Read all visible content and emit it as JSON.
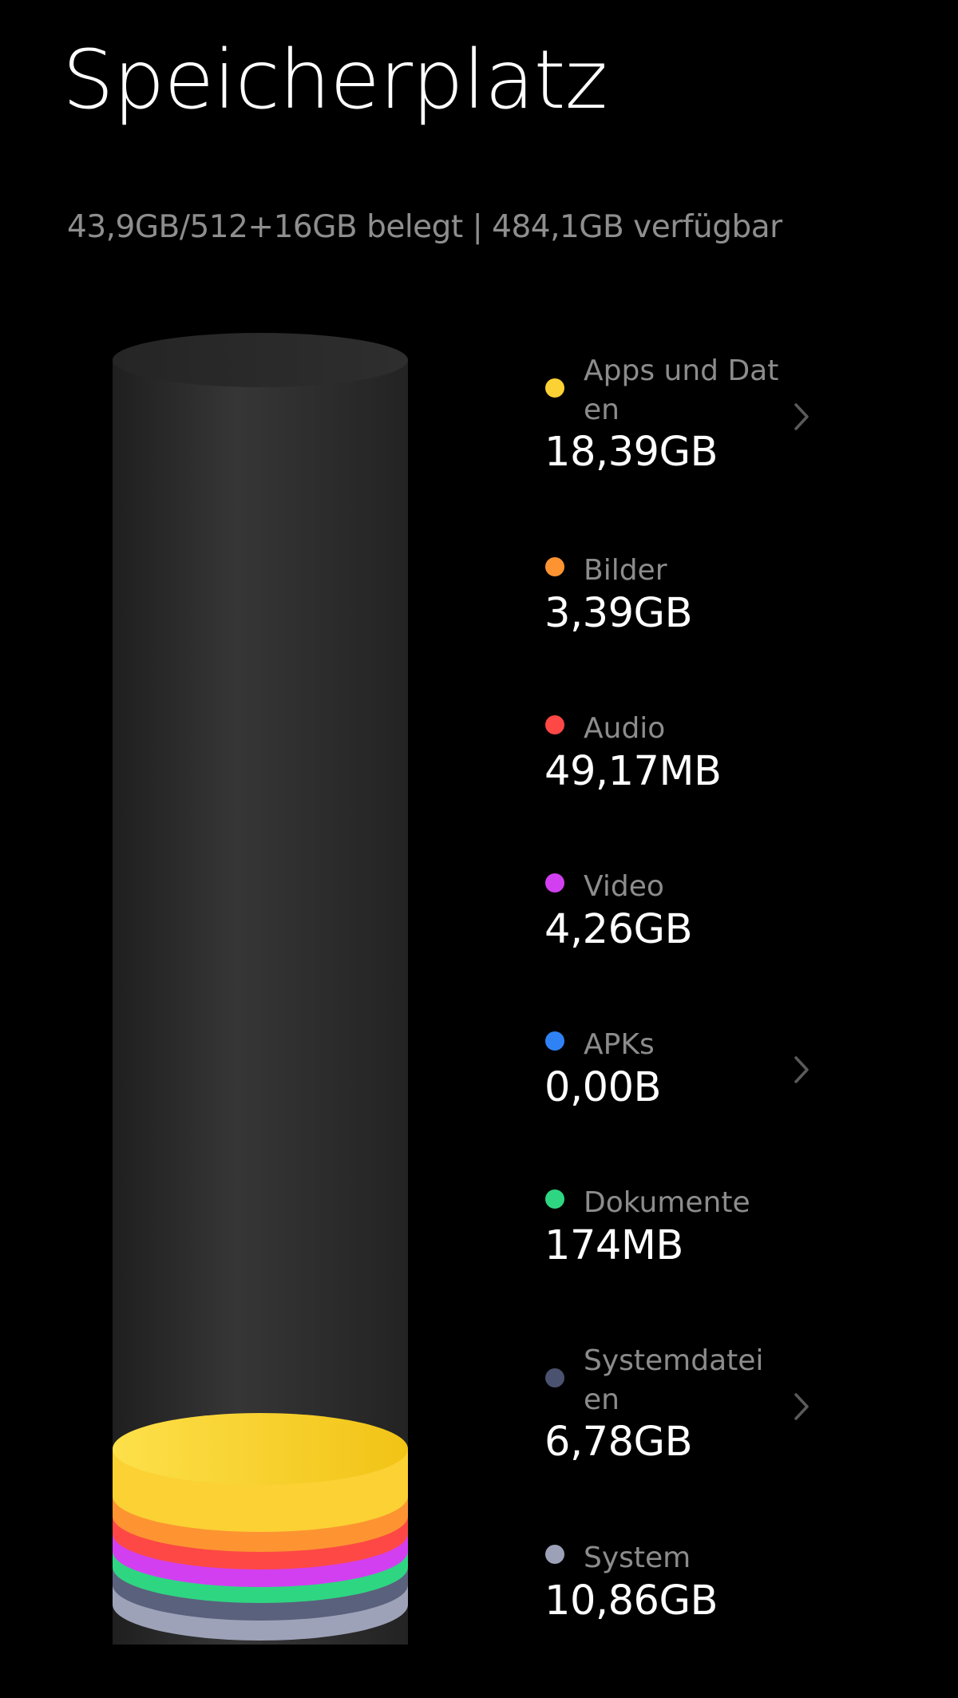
{
  "header": {
    "title": "Speicherplatz",
    "usage_summary": "43,9GB/512+16GB belegt | 484,1GB verfügbar"
  },
  "categories": [
    {
      "label": "Apps und Daten",
      "value": "18,39GB",
      "color": "#fbd134",
      "has_chevron": true
    },
    {
      "label": "Bilder",
      "value": "3,39GB",
      "color": "#fd9431",
      "has_chevron": false
    },
    {
      "label": "Audio",
      "value": "49,17MB",
      "color": "#fd4845",
      "has_chevron": false
    },
    {
      "label": "Video",
      "value": "4,26GB",
      "color": "#d23ff0",
      "has_chevron": false
    },
    {
      "label": "APKs",
      "value": "0,00B",
      "color": "#2f82f5",
      "has_chevron": true
    },
    {
      "label": "Dokumente",
      "value": "174MB",
      "color": "#2fd682",
      "has_chevron": false
    },
    {
      "label": "Systemdateien",
      "value": "6,78GB",
      "color": "#4b5270",
      "has_chevron": true
    },
    {
      "label": "System",
      "value": "10,86GB",
      "color": "#9da1b8",
      "has_chevron": false
    }
  ],
  "icons": {
    "chevron": "chevron-right-icon"
  }
}
